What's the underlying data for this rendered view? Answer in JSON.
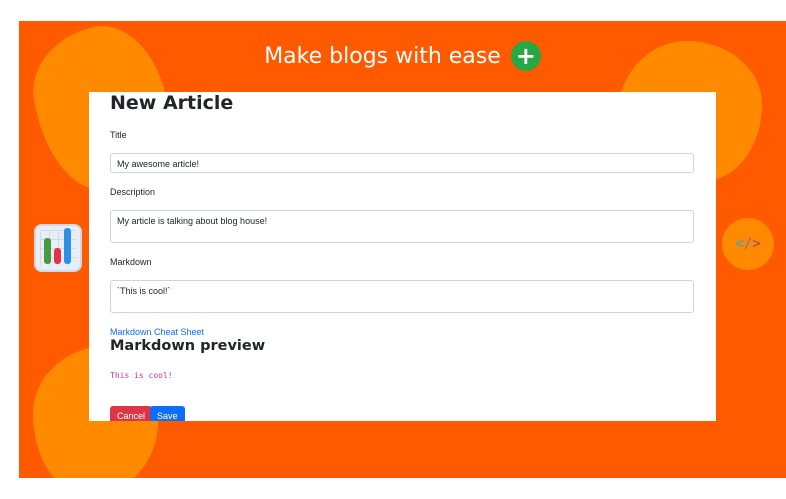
{
  "header": {
    "title": "Make blogs with ease",
    "action_glyph": "+"
  },
  "decor": {
    "code_icon": "</>"
  },
  "form": {
    "heading": "New Article",
    "title_label": "Title",
    "title_value": "My awesome article!",
    "description_label": "Description",
    "description_value": "My article is talking about blog house!",
    "markdown_label": "Markdown",
    "markdown_value": "`This is cool!`",
    "cheat_sheet_link": "Markdown Cheat Sheet",
    "preview_heading": "Markdown preview",
    "preview_content": "This is cool!",
    "cancel_label": "Cancel",
    "save_label": "Save"
  },
  "colors": {
    "background": "#ff5a00",
    "blob": "#ff8a00",
    "add_button": "#28a745",
    "cancel": "#dc3545",
    "save": "#0d6efd",
    "link": "#0d6efd",
    "code_preview": "#d63384"
  }
}
